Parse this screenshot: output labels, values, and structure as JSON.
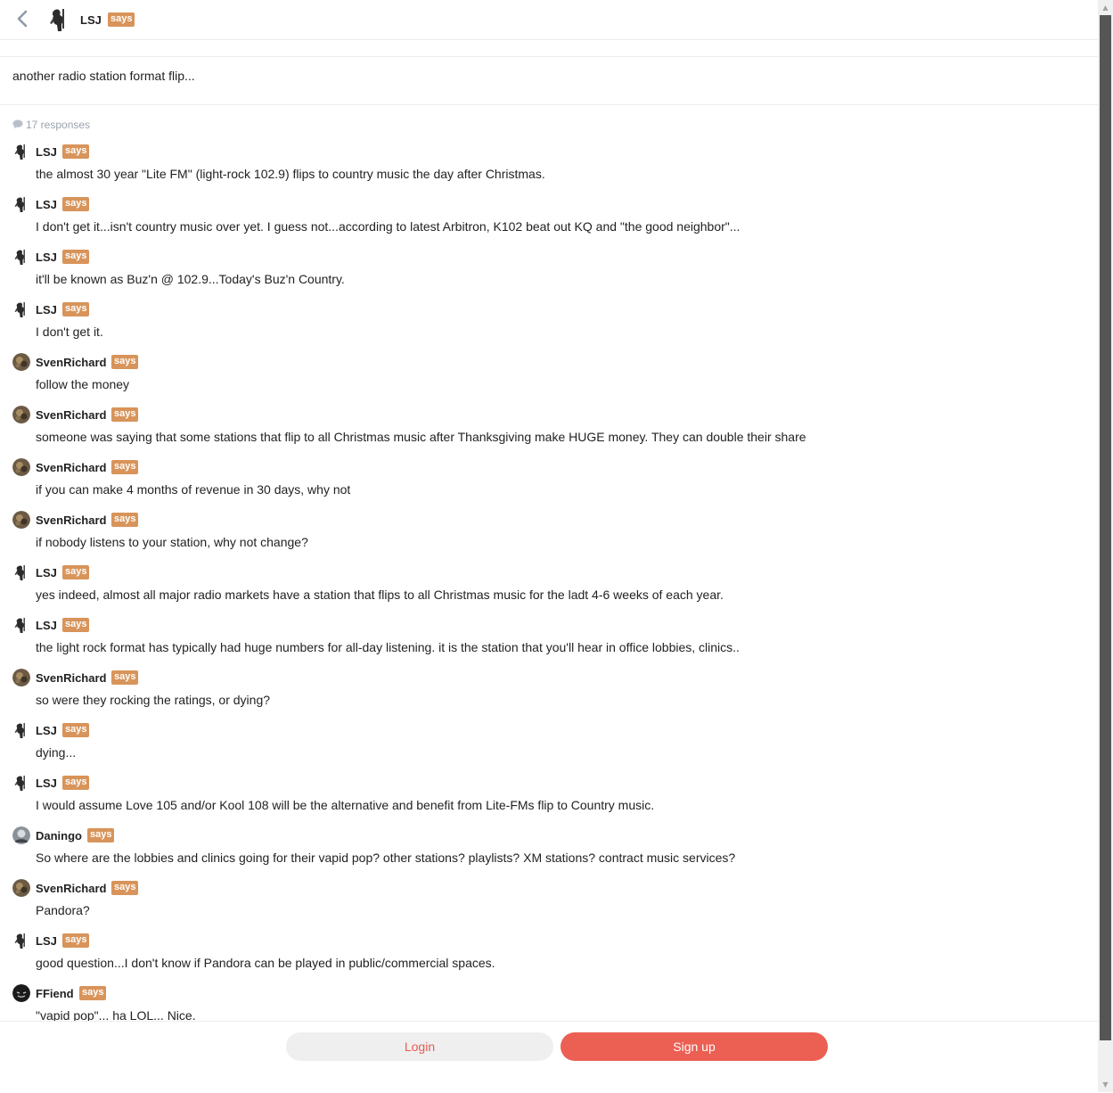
{
  "header": {
    "author": "LSJ",
    "says": "says"
  },
  "post": {
    "title": "another radio station format flip..."
  },
  "responses_label": "17 responses",
  "comments": [
    {
      "author": "LSJ",
      "avatar": "lsj",
      "says": "says",
      "text": "the almost 30 year \"Lite FM\" (light-rock 102.9) flips to country music the day after Christmas."
    },
    {
      "author": "LSJ",
      "avatar": "lsj",
      "says": "says",
      "text": "I don't get it...isn't country music over yet. I guess not...according to latest Arbitron, K102 beat out KQ and \"the good neighbor\"..."
    },
    {
      "author": "LSJ",
      "avatar": "lsj",
      "says": "says",
      "text": "it'll be known as Buz'n @ 102.9...Today's Buz'n Country."
    },
    {
      "author": "LSJ",
      "avatar": "lsj",
      "says": "says",
      "text": "I don't get it."
    },
    {
      "author": "SvenRichard",
      "avatar": "sven",
      "says": "says",
      "text": "follow the money"
    },
    {
      "author": "SvenRichard",
      "avatar": "sven",
      "says": "says",
      "text": "someone was saying that some stations that flip to all Christmas music after Thanksgiving make HUGE money. They can double their share"
    },
    {
      "author": "SvenRichard",
      "avatar": "sven",
      "says": "says",
      "text": "if you can make 4 months of revenue in 30 days, why not"
    },
    {
      "author": "SvenRichard",
      "avatar": "sven",
      "says": "says",
      "text": "if nobody listens to your station, why not change?"
    },
    {
      "author": "LSJ",
      "avatar": "lsj",
      "says": "says",
      "text": "yes indeed, almost all major radio markets have a station that flips to all Christmas music for the ladt 4-6 weeks of each year."
    },
    {
      "author": "LSJ",
      "avatar": "lsj",
      "says": "says",
      "text": "the light rock format has typically had huge numbers for all-day listening. it is the station that you'll hear in office lobbies, clinics.."
    },
    {
      "author": "SvenRichard",
      "avatar": "sven",
      "says": "says",
      "text": "so were they rocking the ratings, or dying?"
    },
    {
      "author": "LSJ",
      "avatar": "lsj",
      "says": "says",
      "text": "dying..."
    },
    {
      "author": "LSJ",
      "avatar": "lsj",
      "says": "says",
      "text": "I would assume Love 105 and/or Kool 108 will be the alternative and benefit from Lite-FMs flip to Country music."
    },
    {
      "author": "Daningo",
      "avatar": "daningo",
      "says": "says",
      "text": "So where are the lobbies and clinics going for their vapid pop? other stations? playlists? XM stations? contract music services?"
    },
    {
      "author": "SvenRichard",
      "avatar": "sven",
      "says": "says",
      "text": "Pandora?"
    },
    {
      "author": "LSJ",
      "avatar": "lsj",
      "says": "says",
      "text": "good question...I don't know if Pandora can be played in public/commercial spaces."
    },
    {
      "author": "FFiend",
      "avatar": "ffiend",
      "says": "says",
      "text": "\"vapid pop\"... ha LOL... Nice."
    }
  ],
  "footer": {
    "login_label": "Login",
    "signup_label": "Sign up"
  },
  "colors": {
    "says_badge": "#d8945a",
    "signup": "#ec5f53",
    "login_text": "#e85d52"
  }
}
